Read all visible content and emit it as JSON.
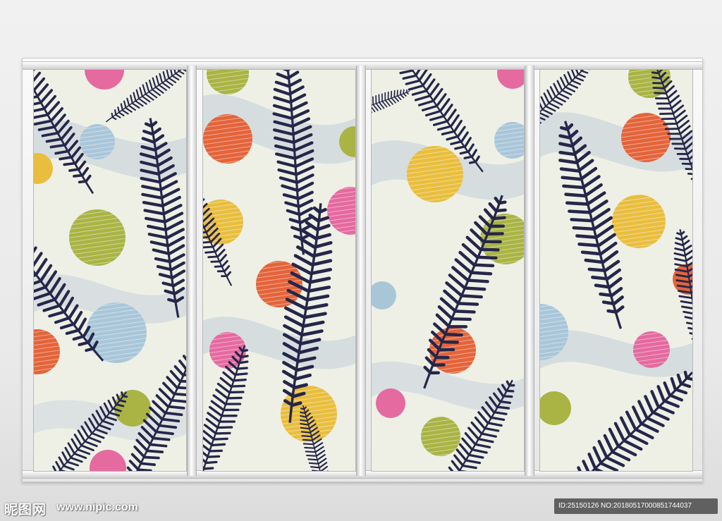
{
  "colors": {
    "background": "#f1f1f1",
    "fern": "#26264a",
    "ground": "#eef0e6",
    "swirl": "#b9c5d6",
    "orange": "#e4643a",
    "yellow": "#e9be3e",
    "olive": "#a9b444",
    "pink": "#e56aa0",
    "blue": "#a9c6d9"
  },
  "icons": [
    "fern-leaf-icon"
  ],
  "watermark": {
    "site_name": "昵图网",
    "site_url": "www.nipic.com",
    "id_text": "ID:25150126 NO:20180517000851744037"
  }
}
